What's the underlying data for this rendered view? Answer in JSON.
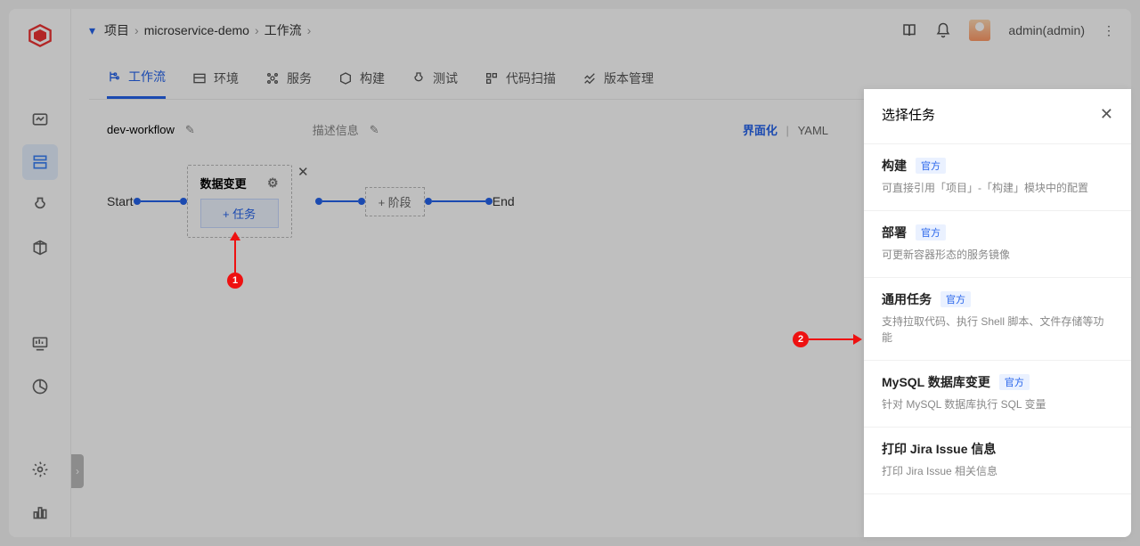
{
  "breadcrumb": {
    "project_label": "项目",
    "project_name": "microservice-demo",
    "section": "工作流"
  },
  "user": {
    "display": "admin(admin)"
  },
  "tabs": {
    "workflow": "工作流",
    "env": "环境",
    "service": "服务",
    "build": "构建",
    "test": "测试",
    "scan": "代码扫描",
    "version": "版本管理"
  },
  "workflow": {
    "name": "dev-workflow",
    "desc_label": "描述信息",
    "mode_ui": "界面化",
    "mode_yaml": "YAML",
    "start": "Start",
    "end": "End",
    "stage_title": "数据变更",
    "add_task": "+ 任务",
    "add_stage": "+ 阶段"
  },
  "panel": {
    "title": "选择任务",
    "official": "官方",
    "items": [
      {
        "title": "构建",
        "official": true,
        "desc": "可直接引用「项目」-「构建」模块中的配置"
      },
      {
        "title": "部署",
        "official": true,
        "desc": "可更新容器形态的服务镜像"
      },
      {
        "title": "通用任务",
        "official": true,
        "desc": "支持拉取代码、执行 Shell 脚本、文件存储等功能"
      },
      {
        "title": "MySQL 数据库变更",
        "official": true,
        "desc": "针对 MySQL 数据库执行 SQL 变量"
      },
      {
        "title": "打印 Jira Issue 信息",
        "official": false,
        "desc": "打印 Jira Issue 相关信息"
      }
    ]
  },
  "callouts": {
    "one": "1",
    "two": "2"
  }
}
